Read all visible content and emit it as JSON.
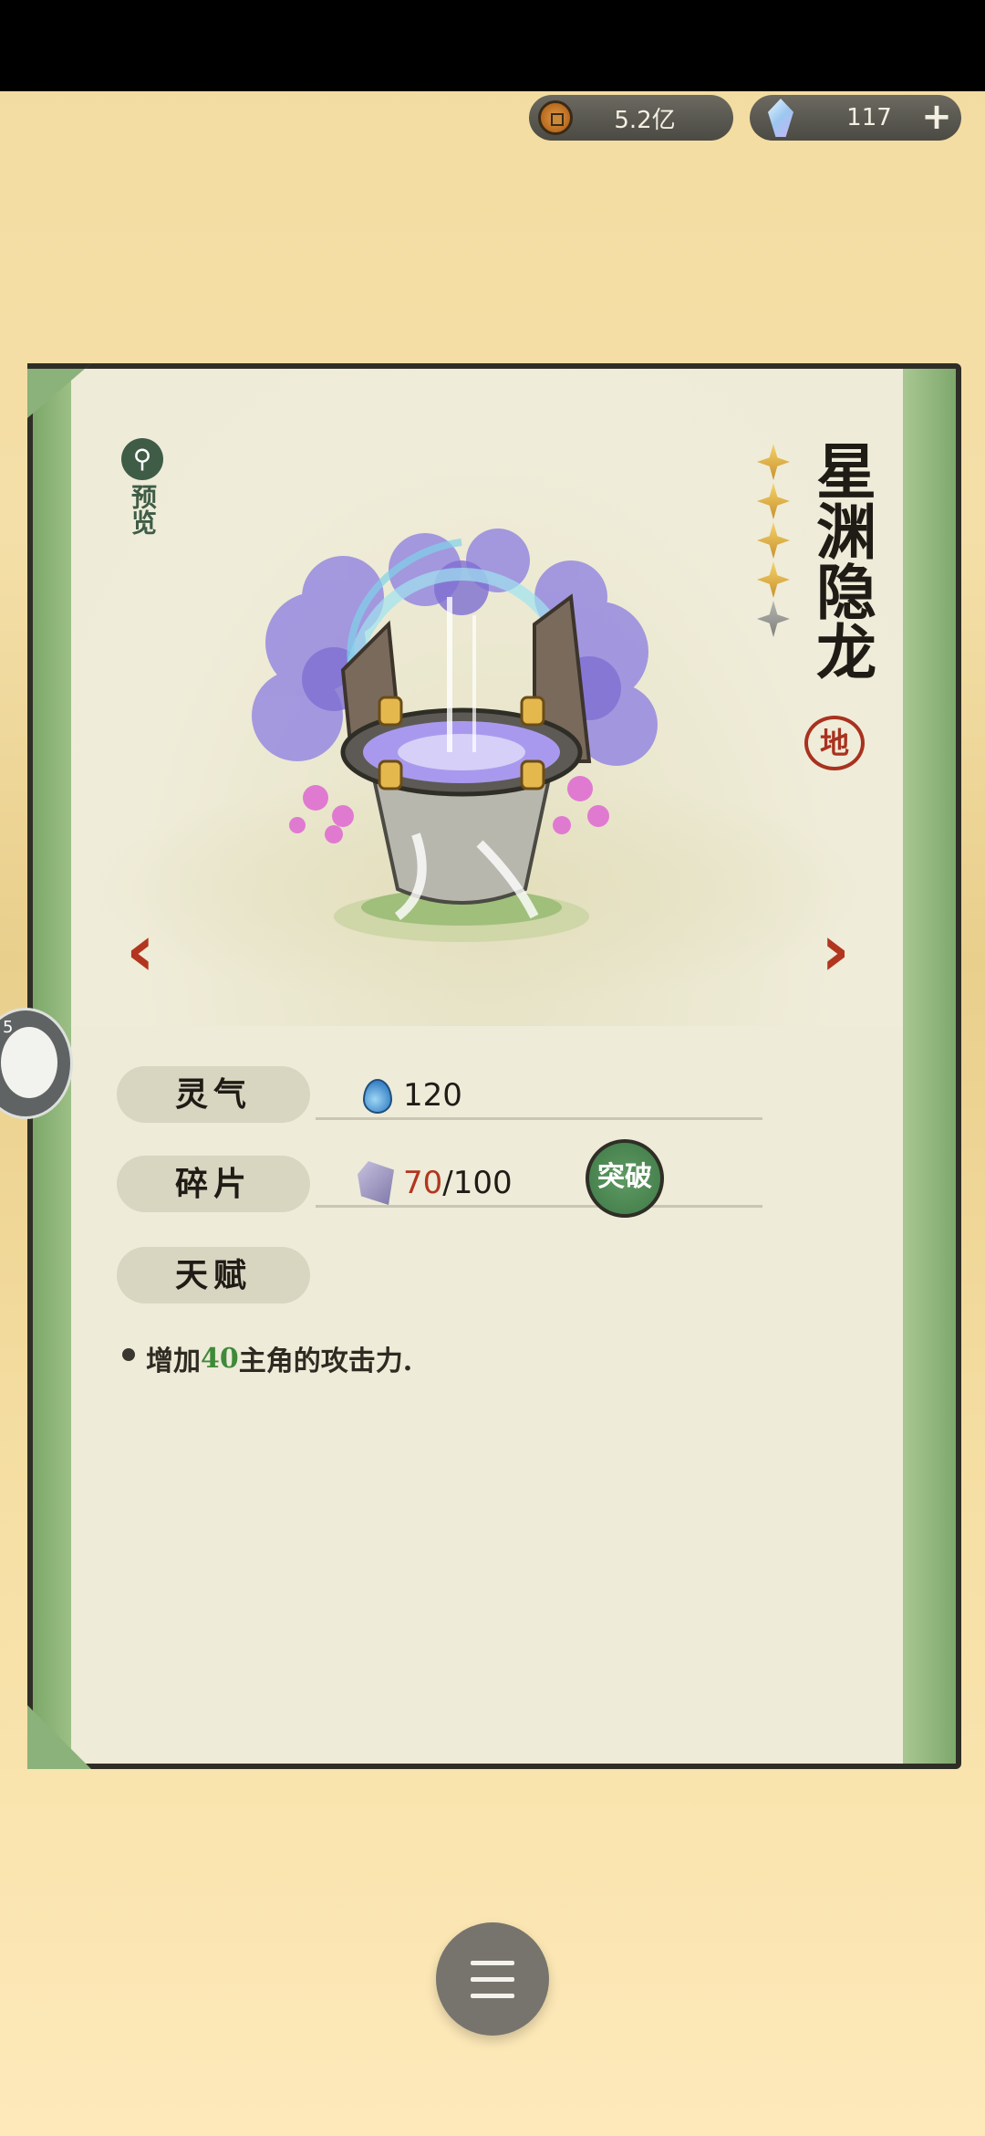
{
  "currency": {
    "coins": "5.2亿",
    "gems": "117",
    "add": "+"
  },
  "item": {
    "name": "星渊隐龙",
    "grade": "地",
    "stars_filled": 4,
    "stars_total": 5,
    "preview_label": "预览"
  },
  "stats": {
    "spirit_label": "灵气",
    "spirit_value": "120",
    "fragment_label": "碎片",
    "fragment_current": "70",
    "fragment_total": "/100",
    "breakthrough_label": "突破",
    "talent_label": "天赋"
  },
  "talent": {
    "prefix": "增加",
    "value": "40",
    "suffix": "主角的攻击力."
  },
  "nav": {
    "prev": "‹",
    "next": "›"
  },
  "side": {
    "badge": "5"
  },
  "colors": {
    "accent_red": "#b2361f",
    "accent_green": "#3f8a3a"
  }
}
